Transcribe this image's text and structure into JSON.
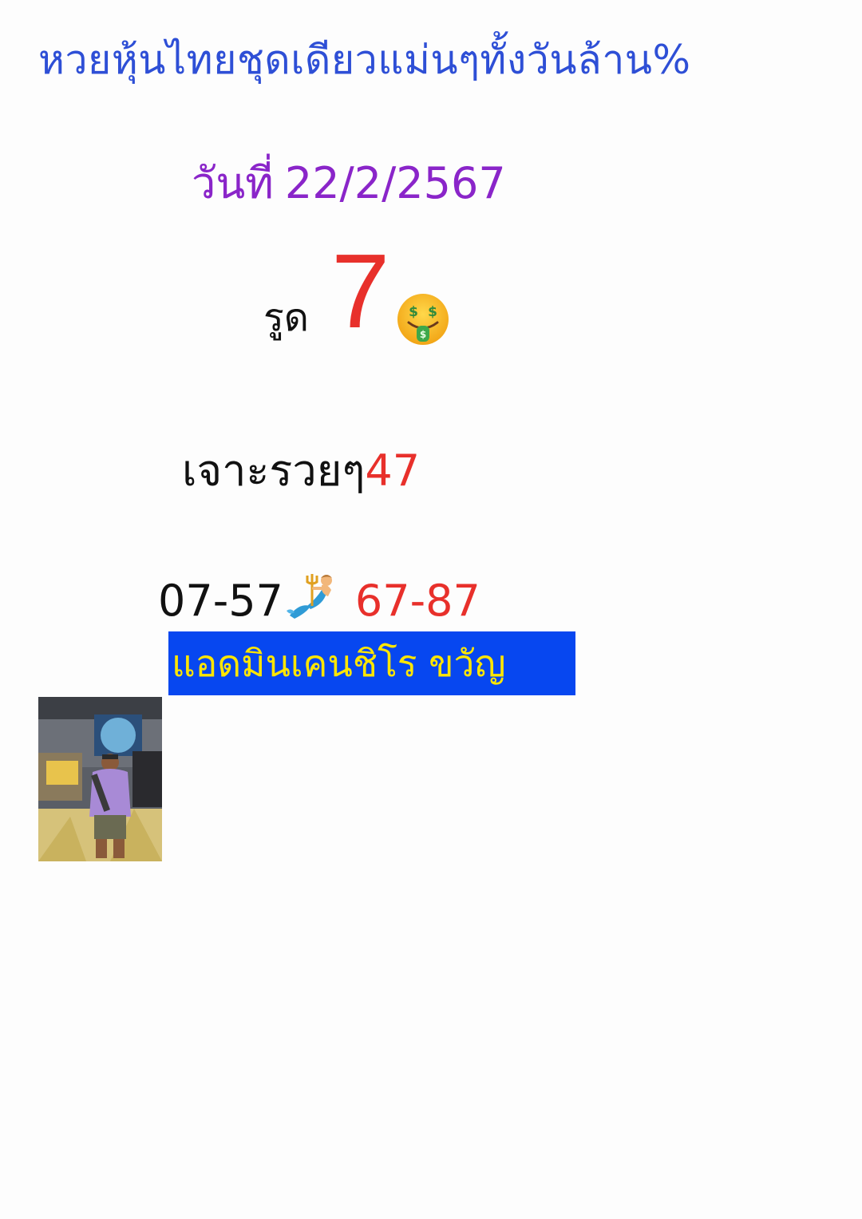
{
  "headline": "หวยหุ้นไทยชุดเดียวแม่นๆทั้งวันล้าน%",
  "date": {
    "label": "วันที่",
    "value": "22/2/2567"
  },
  "root": {
    "label": "รูด",
    "digit": "7",
    "emoji_icon": "money-mouth-face-icon"
  },
  "pierce": {
    "label": "เจาะรวยๆ",
    "number": "47"
  },
  "pairs": {
    "left": "07-57",
    "icon": "merman-icon",
    "right": "67-87"
  },
  "admin_banner": "แอดมินเคนชิโร ขวัญ",
  "colors": {
    "headline": "#2e4fd6",
    "date": "#8a25c9",
    "accent_red": "#e8302b",
    "banner_bg": "#0747f0",
    "banner_text": "#ffe600"
  }
}
